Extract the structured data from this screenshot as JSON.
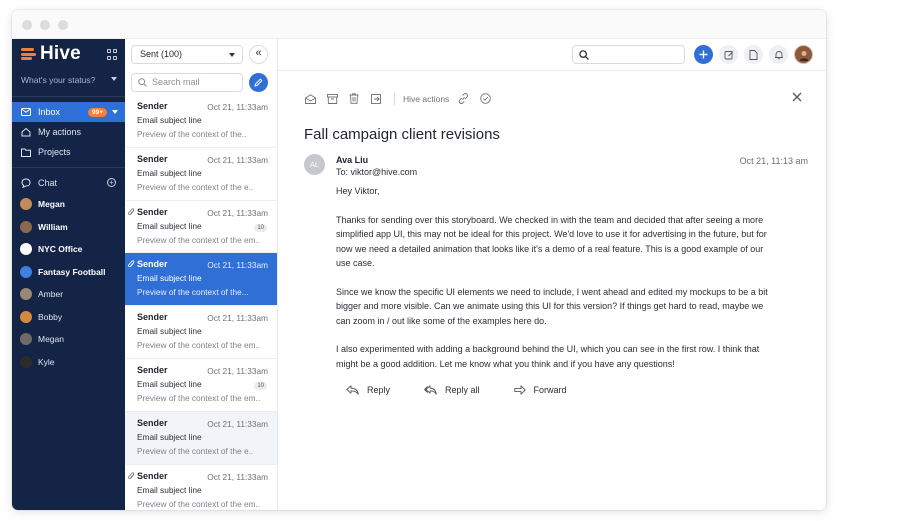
{
  "sidebar": {
    "logo": "Hive",
    "status_placeholder": "What's your status?",
    "nav": [
      {
        "label": "Inbox",
        "badge": "99+"
      },
      {
        "label": "My actions"
      },
      {
        "label": "Projects"
      }
    ],
    "chat_label": "Chat",
    "chats": [
      {
        "name": "Megan",
        "bold": true,
        "color": "#c58b5a"
      },
      {
        "name": "William",
        "bold": true,
        "color": "#8a6a4f"
      },
      {
        "name": "NYC Office",
        "bold": true,
        "color": "#ffffff"
      },
      {
        "name": "Fantasy Football",
        "bold": true,
        "color": "#3f7fe0"
      },
      {
        "name": "Amber",
        "bold": false,
        "color": "#9a8877"
      },
      {
        "name": "Bobby",
        "bold": false,
        "color": "#d38a3f"
      },
      {
        "name": "Megan",
        "bold": false,
        "color": "#6f6a66"
      },
      {
        "name": "Kyle",
        "bold": false,
        "color": "#2b2b2b"
      }
    ]
  },
  "list": {
    "folder": "Sent (100)",
    "search_placeholder": "Search mail",
    "messages": [
      {
        "sender": "Sender",
        "date": "Oct 21, 11:33am",
        "subject": "Email subject line",
        "preview": "Preview of the context of the..",
        "attachment": false,
        "count": "",
        "state": "normal"
      },
      {
        "sender": "Sender",
        "date": "Oct 21, 11:33am",
        "subject": "Email subject line",
        "preview": "Preview of the context of the e..",
        "attachment": false,
        "count": "",
        "state": "normal"
      },
      {
        "sender": "Sender",
        "date": "Oct 21, 11:33am",
        "subject": "Email subject line",
        "preview": "Preview of the context of the em..",
        "attachment": true,
        "count": "10",
        "state": "normal"
      },
      {
        "sender": "Sender",
        "date": "Oct 21, 11:33am",
        "subject": "Email subject line",
        "preview": "Preview of the context of the...",
        "attachment": true,
        "count": "",
        "state": "selected"
      },
      {
        "sender": "Sender",
        "date": "Oct 21, 11:33am",
        "subject": "Email subject line",
        "preview": "Preview of the context of the em..",
        "attachment": false,
        "count": "",
        "state": "normal"
      },
      {
        "sender": "Sender",
        "date": "Oct 21, 11:33am",
        "subject": "Email subject line",
        "preview": "Preview of the context of the em..",
        "attachment": false,
        "count": "10",
        "state": "normal"
      },
      {
        "sender": "Sender",
        "date": "Oct 21, 11:33am",
        "subject": "Email subject line",
        "preview": "Preview of the context of the e..",
        "attachment": false,
        "count": "",
        "state": "tinted"
      },
      {
        "sender": "Sender",
        "date": "Oct 21, 11:33am",
        "subject": "Email subject line",
        "preview": "Preview of the context of the em..",
        "attachment": true,
        "count": "",
        "state": "normal"
      }
    ]
  },
  "reader": {
    "toolbar_label": "Hive actions",
    "subject": "Fall campaign client revisions",
    "avatar_initials": "AL",
    "from_name": "Ava Liu",
    "to": "To: viktor@hive.com",
    "date": "Oct 21, 11:13 am",
    "greeting": "Hey Viktor,",
    "paragraphs": [
      "Thanks for sending over this storyboard. We checked in with the team and decided that after seeing a more simplified app UI, this may not be ideal for this project. We'd love to use it for advertising in the future, but for now we need a detailed animation that looks like it's a demo of a real feature. This is a good example of our use case.",
      "Since we know the specific UI elements we need to include, I went ahead and edited my mockups to be a bit bigger and more visible. Can we animate using this UI for this version? If things get hard to read, maybe we can zoom in / out like some of the examples here do.",
      "I also experimented with adding a background behind the UI, which you can see in the first row. I think that might be a good addition. Let me know what you think and if you have any questions!"
    ],
    "actions": {
      "reply": "Reply",
      "reply_all": "Reply all",
      "forward": "Forward"
    }
  },
  "colors": {
    "sidebar": "#142446",
    "accent": "#2f6fd6",
    "logo": "#f0813a"
  }
}
